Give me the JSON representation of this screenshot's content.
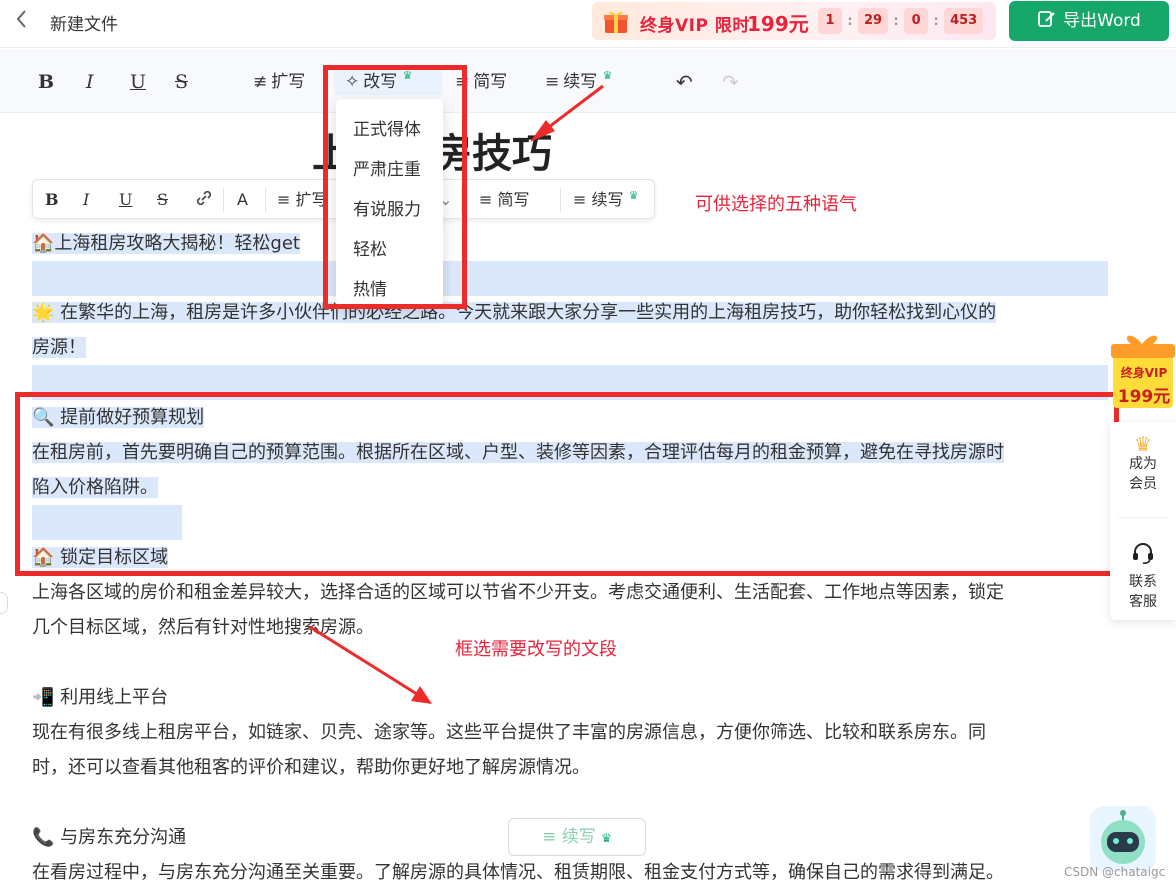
{
  "header": {
    "back_icon": "chevron-left-icon",
    "title": "新建文件",
    "vip_gift_icon": "gift-icon",
    "vip_text": "终身VIP 限时",
    "vip_price": "199元",
    "countdown": [
      "1",
      "29",
      "0",
      "453"
    ],
    "export_label": "导出Word",
    "export_icon": "edit-document-icon"
  },
  "toolbar": {
    "bold": "B",
    "italic": "I",
    "underline": "U",
    "strike": "S",
    "expand": "扩写",
    "rewrite": "改写",
    "simplify": "简写",
    "continue": "续写"
  },
  "rewrite_menu": {
    "items": [
      "正式得体",
      "严肃庄重",
      "有说服力",
      "轻松",
      "热情"
    ]
  },
  "doc": {
    "heading": "上海租房技巧",
    "lines": [
      "🏠上海租房攻略大揭秘！轻松get",
      "🌟 在繁华的上海，租房是许多小伙伴们的必经之路。今天就来跟大家分享一些实用的上海租房技巧，助你轻松找到心仪的",
      "房源！",
      "🔍 提前做好预算规划",
      "在租房前，首先要明确自己的预算范围。根据所在区域、户型、装修等因素，合理评估每月的租金预算，避免在寻找房源时",
      "陷入价格陷阱。",
      "🏠 锁定目标区域",
      "上海各区域的房价和租金差异较大，选择合适的区域可以节省不少开支。考虑交通便利、生活配套、工作地点等因素，锁定",
      "几个目标区域，然后有针对性地搜索房源。",
      "📲 利用线上平台",
      "现在有很多线上租房平台，如链家、贝壳、途家等。这些平台提供了丰富的房源信息，方便你筛选、比较和联系房东。同",
      "时，还可以查看其他租客的评价和建议，帮助你更好地了解房源情况。",
      "📞 与房东充分沟通",
      "在看房过程中，与房东充分沟通至关重要。了解房源的具体情况、租赁期限、租金支付方式等，确保自己的需求得到满足。"
    ]
  },
  "float_toolbar": {
    "expand": "扩写",
    "simplify": "简写",
    "continue": "续写",
    "font_label": "A"
  },
  "annotations": {
    "tone_note": "可供选择的五种语气",
    "select_note": "框选需要改写的文段"
  },
  "sidebar": {
    "vip_line1": "终身VIP",
    "vip_line2": "199元",
    "member_line1": "成为",
    "member_line2": "会员",
    "contact_line1": "联系",
    "contact_line2": "客服"
  },
  "bottom": {
    "continue_label": "续写"
  },
  "watermark": "CSDN @chataigc",
  "colors": {
    "accent_green": "#15a86a",
    "vip_red": "#e8243c",
    "annotation_red": "#ee2b2b",
    "highlight": "#dbe8fb"
  }
}
